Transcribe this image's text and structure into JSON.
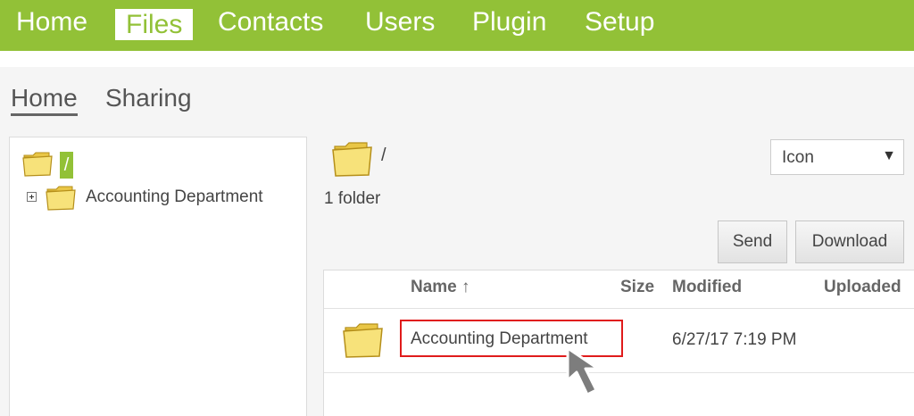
{
  "nav": {
    "items": [
      "Home",
      "Files",
      "Contacts",
      "Users",
      "Plugin",
      "Setup"
    ],
    "active": "Files"
  },
  "subtabs": [
    "Home",
    "Sharing"
  ],
  "tree": {
    "root_label": "/",
    "children": [
      "Accounting Department"
    ]
  },
  "breadcrumb": {
    "path": "/"
  },
  "folder_count": "1 folder",
  "view_select": {
    "value": "Icon",
    "arrow": "▼"
  },
  "buttons": {
    "send": "Send",
    "download": "Download"
  },
  "table": {
    "headers": {
      "name": "Name ↑",
      "size": "Size",
      "modified": "Modified",
      "uploaded": "Uploaded"
    },
    "rows": [
      {
        "name": "Accounting Department",
        "size": "",
        "modified": "6/27/17 7:19 PM"
      }
    ]
  },
  "colors": {
    "nav_bg": "#92c137",
    "highlight_border": "#e01b1b",
    "folder_yellow": "#f5dc63"
  }
}
